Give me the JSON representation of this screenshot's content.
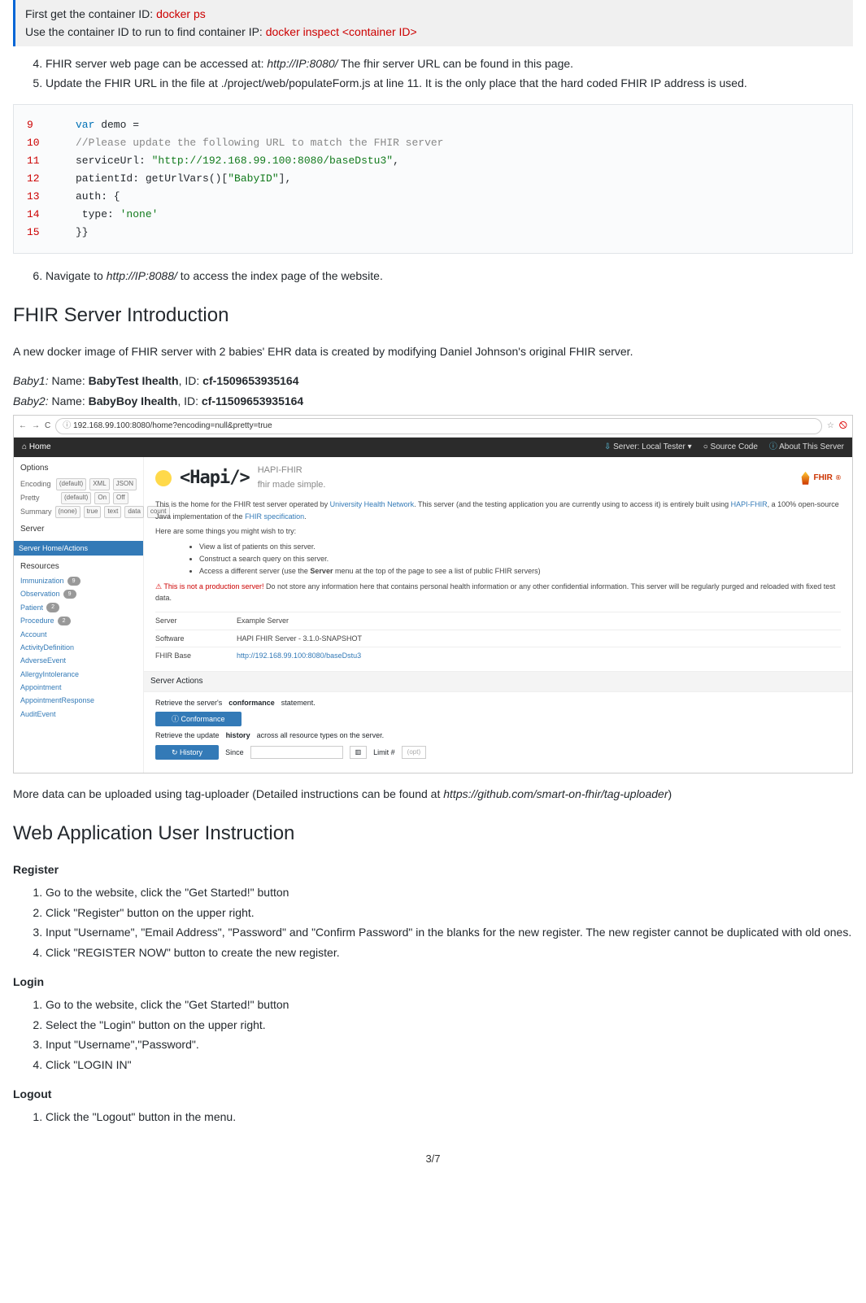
{
  "blockquote": {
    "line1_a": "First get the container ID: ",
    "line1_b": "docker ps",
    "line2_a": "Use the container ID to run to find container IP: ",
    "line2_b": "docker inspect <container ID>"
  },
  "ol1": {
    "li4_a": "FHIR server web page can be accessed at: ",
    "li4_b": "http://IP:8080/",
    "li4_c": " The fhir server URL can be found in this page.",
    "li5": "Update the FHIR URL in the file at ./project/web/populateForm.js at line 11. It is the only place that the hard coded FHIR IP address is used."
  },
  "code": {
    "l9n": "9",
    "l9a": "var",
    "l9b": " demo =",
    "l10n": "10",
    "l10": "//Please update the following URL to match the FHIR server",
    "l11n": "11",
    "l11a": "serviceUrl: ",
    "l11b": "\"http://192.168.99.100:8080/baseDstu3\"",
    "l11c": ",",
    "l12n": "12",
    "l12a": "patientId: getUrlVars()[",
    "l12b": "\"BabyID\"",
    "l12c": "],",
    "l13n": "13",
    "l13": "auth: {",
    "l14n": "14",
    "l14a": "  type: ",
    "l14b": "'none'",
    "l15n": "15",
    "l15": "}}"
  },
  "ol2": {
    "li6_a": "Navigate to ",
    "li6_b": "http://IP:8088/",
    "li6_c": " to access the index page of the website."
  },
  "h_intro": "FHIR Server Introduction",
  "intro_p": "A new docker image of FHIR server with 2 babies' EHR data is created by modifying Daniel Johnson's original FHIR server.",
  "baby1": {
    "pre": "Baby1:",
    "mid": " Name: ",
    "name": "BabyTest Ihealth",
    "idlbl": ", ID: ",
    "id": "cf-1509653935164"
  },
  "baby2": {
    "pre": "Baby2:",
    "mid": " Name: ",
    "name": "BabyBoy Ihealth",
    "idlbl": ", ID: ",
    "id": "cf-11509653935164"
  },
  "ss": {
    "url": "192.168.99.100:8080/home?encoding=null&pretty=true",
    "home": "Home",
    "nav_server": "Server: Local Tester",
    "nav_source": "Source Code",
    "nav_about": "About This Server",
    "options": "Options",
    "enc": "Encoding",
    "enc_def": "(default)",
    "enc_xml": "XML",
    "enc_json": "JSON",
    "pretty": "Pretty",
    "pretty_def": "(default)",
    "pretty_on": "On",
    "pretty_off": "Off",
    "summary": "Summary",
    "sum_none": "(none)",
    "sum_true": "true",
    "sum_text": "text",
    "sum_data": "data",
    "sum_count": "count",
    "server_lbl": "Server",
    "server_home": "Server Home/Actions",
    "resources": "Resources",
    "res": [
      {
        "name": "Immunization",
        "count": "9"
      },
      {
        "name": "Observation",
        "count": "9"
      },
      {
        "name": "Patient",
        "count": "2"
      },
      {
        "name": "Procedure",
        "count": "2"
      },
      {
        "name": "Account",
        "count": ""
      },
      {
        "name": "ActivityDefinition",
        "count": ""
      },
      {
        "name": "AdverseEvent",
        "count": ""
      },
      {
        "name": "AllergyIntolerance",
        "count": ""
      },
      {
        "name": "Appointment",
        "count": ""
      },
      {
        "name": "AppointmentResponse",
        "count": ""
      },
      {
        "name": "AuditEvent",
        "count": ""
      }
    ],
    "logo": "<Hapi/>",
    "tag1": "HAPI-FHIR",
    "tag2": "fhir made simple.",
    "fhir": "FHIR",
    "para1a": "This is the home for the FHIR test server operated by ",
    "para1b": "University Health Network",
    "para1c": ". This server (and the testing application you are currently using to access it) is entirely built using ",
    "para1d": "HAPI-FHIR",
    "para1e": ", a 100% open-source Java implementation of the ",
    "para1f": "FHIR specification",
    "para1g": ".",
    "para2": "Here are some things you might wish to try:",
    "b1a": "View a ",
    "b1b": "list of patients",
    "b1c": " on this server.",
    "b2a": "Construct a ",
    "b2b": "search query",
    "b2c": " on this server.",
    "b3a": "Access a ",
    "b3b": "different server",
    "b3c": " (use the ",
    "b3d": "Server",
    "b3e": " menu at the top of the page to see a list of public FHIR servers)",
    "warn1": "This is not a production server!",
    "warn2": " Do not store any information here that contains personal health information or any other confidential information. This server will be regularly purged and reloaded with fixed test data.",
    "tbl": {
      "k1": "Server",
      "v1": "Example Server",
      "k2": "Software",
      "v2": "HAPI FHIR Server - 3.1.0-SNAPSHOT",
      "k3": "FHIR Base",
      "v3": "http://192.168.99.100:8080/baseDstu3"
    },
    "actions_hdr": "Server Actions",
    "act1_txt": "Retrieve the server's ",
    "act1_b": "conformance",
    "act1_c": " statement.",
    "act1_btn": "Conformance",
    "act2_txt": "Retrieve the update ",
    "act2_b": "history",
    "act2_c": " across all resource types on the server.",
    "act2_btn": "History",
    "act2_since": "Since",
    "act2_limit": "Limit #",
    "act2_opt": "(opt)"
  },
  "more_a": "More data can be uploaded using tag-uploader (Detailed instructions can be found at ",
  "more_b": "https://github.com/smart-on-fhir/tag-uploader",
  "more_c": ")",
  "h_web": "Web Application User Instruction",
  "h_reg": "Register",
  "reg": [
    "Go to the website, click the \"Get Started!\" button",
    "Click \"Register\" button on the upper right.",
    "Input \"Username\", \"Email Address\", \"Password\" and \"Confirm Password\" in the blanks for the new register. The new register cannot be duplicated with old ones.",
    "Click \"REGISTER NOW\" button to create the new register."
  ],
  "h_login": "Login",
  "login": [
    "Go to the website, click the \"Get Started!\" button",
    "Select the \"Login\" button on the upper right.",
    "Input \"Username\",\"Password\".",
    "Click \"LOGIN IN\""
  ],
  "h_logout": "Logout",
  "logout": [
    "Click the \"Logout\" button in the menu."
  ],
  "page": "3/7"
}
